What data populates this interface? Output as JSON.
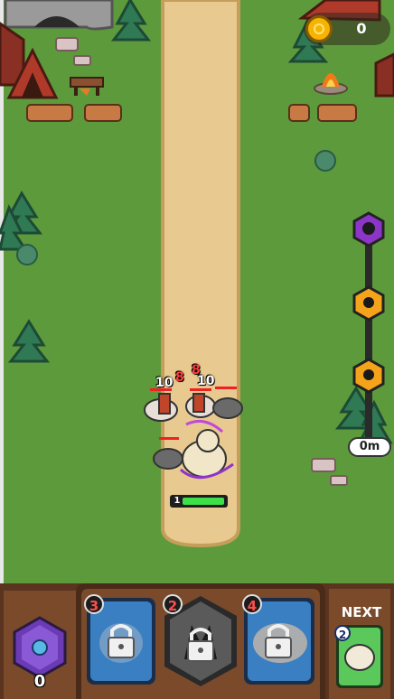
{
  "hud": {
    "coins": "0",
    "distance": "0m",
    "mana": "0",
    "next_label": "NEXT",
    "next_card_cost": "2"
  },
  "battle": {
    "damage_numbers": [
      "10",
      "8",
      "8",
      "10"
    ],
    "hero_level": "1"
  },
  "cards": [
    {
      "cost": "3",
      "icon": "lock-icon",
      "state": "locked"
    },
    {
      "cost": "2",
      "icon": "lock-icon",
      "state": "locked"
    },
    {
      "cost": "4",
      "icon": "lock-icon",
      "state": "locked"
    }
  ],
  "progress_markers": [
    "skull-boss-icon",
    "skull-icon",
    "skull-icon"
  ],
  "colors": {
    "grass": "#5d9a3c",
    "path": "#e8c98f",
    "wood_panel": "#7a4a2b",
    "card_blue": "#3a7fc1",
    "card_grey": "#5a5a5a",
    "mana_purple": "#6a3bb5",
    "coin_gold": "#f4b400",
    "boss_purple": "#8e35c9",
    "marker_orange": "#f5a31a"
  }
}
